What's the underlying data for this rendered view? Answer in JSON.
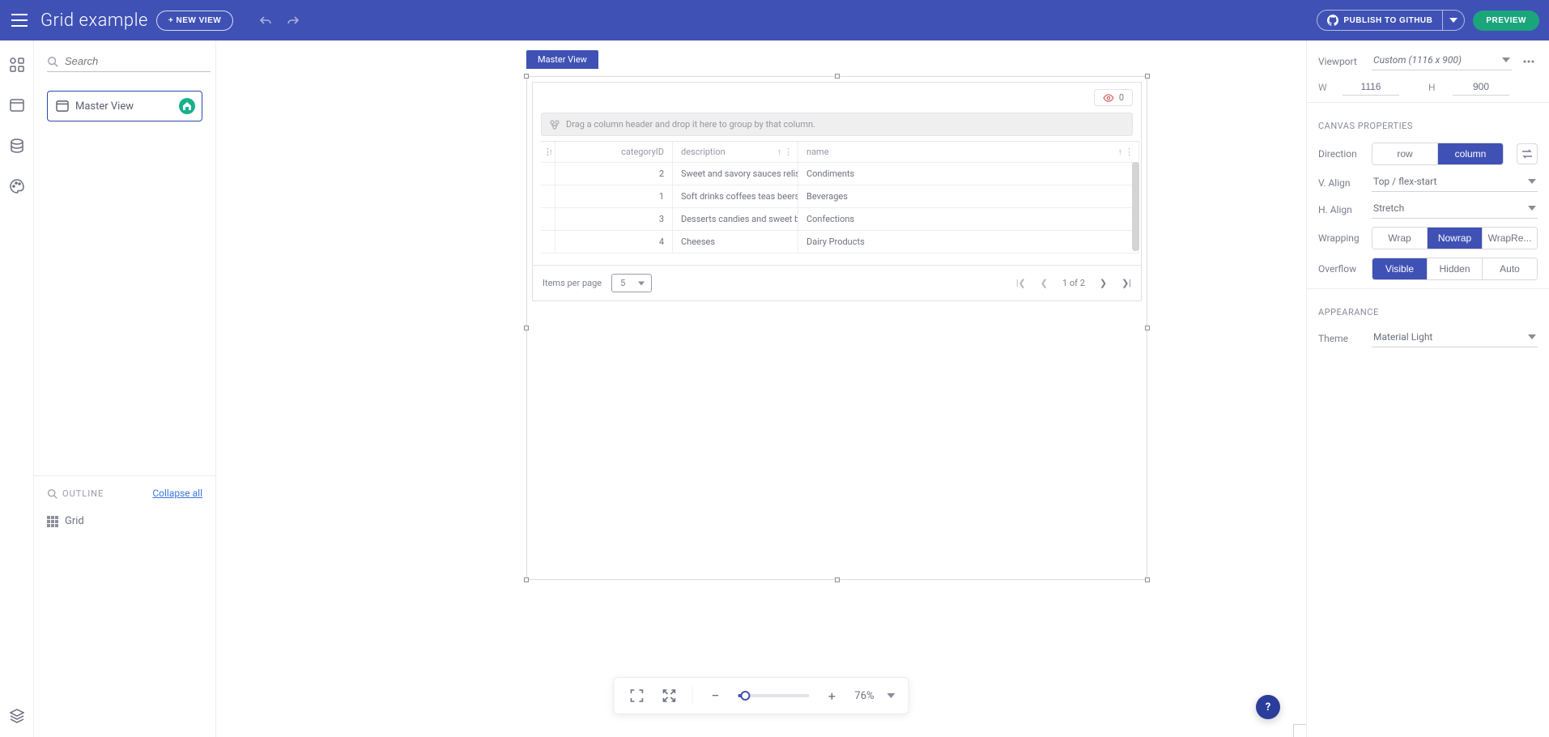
{
  "header": {
    "title": "Grid example",
    "new_view": "+ NEW VIEW",
    "publish": "PUBLISH TO GITHUB",
    "preview": "PREVIEW"
  },
  "left": {
    "search_placeholder": "Search",
    "views": [
      {
        "name": "Master View"
      }
    ],
    "outline": {
      "title": "OUTLINE",
      "collapse": "Collapse all",
      "items": [
        {
          "label": "Grid"
        }
      ]
    }
  },
  "canvas": {
    "artboard_label": "Master View",
    "grid": {
      "eye_count": "0",
      "group_hint": "Drag a column header and drop it here to group by that column.",
      "headers": {
        "col1": "categoryID",
        "col2": "description",
        "col3": "name"
      },
      "rows": [
        {
          "id": "2",
          "desc": "Sweet and savory sauces relishes sp...",
          "name": "Condiments"
        },
        {
          "id": "1",
          "desc": "Soft drinks coffees teas beers and al...",
          "name": "Beverages"
        },
        {
          "id": "3",
          "desc": "Desserts candies and sweet breads",
          "name": "Confections"
        },
        {
          "id": "4",
          "desc": "Cheeses",
          "name": "Dairy Products"
        }
      ],
      "pager": {
        "label": "Items per page",
        "size": "5",
        "pages": "1 of 2"
      }
    },
    "zoom_pct": "76%"
  },
  "right": {
    "viewport_label": "Viewport",
    "viewport_value": "Custom (1116 x 900)",
    "w_label": "W",
    "w_value": "1116",
    "h_label": "H",
    "h_value": "900",
    "section_canvas": "CANVAS PROPERTIES",
    "direction_label": "Direction",
    "direction_row": "row",
    "direction_col": "column",
    "valign_label": "V. Align",
    "valign_value": "Top / flex-start",
    "halign_label": "H. Align",
    "halign_value": "Stretch",
    "wrap_label": "Wrapping",
    "wrap_wrap": "Wrap",
    "wrap_nowrap": "Nowrap",
    "wrap_rev": "WrapRe...",
    "overflow_label": "Overflow",
    "ov_visible": "Visible",
    "ov_hidden": "Hidden",
    "ov_auto": "Auto",
    "section_appearance": "APPEARANCE",
    "theme_label": "Theme",
    "theme_value": "Material Light"
  }
}
